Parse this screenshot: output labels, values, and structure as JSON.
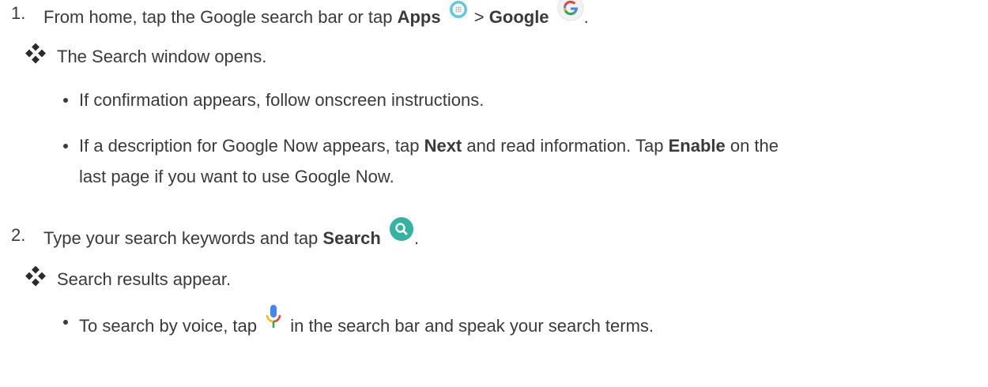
{
  "steps": [
    {
      "number": "1.",
      "text_a": "From home, tap the Google search bar or tap ",
      "apps": "Apps",
      "sep": " > ",
      "google": "Google",
      "end": ".",
      "result": "The Search window opens.",
      "bullets": [
        "If confirmation appears, follow onscreen instructions.",
        {
          "a": "If a description for Google Now appears, tap ",
          "next": "Next",
          "b": " and read information. Tap ",
          "enable": "Enable",
          "c": " on the",
          "line2": "last page if you want to use Google Now."
        }
      ]
    },
    {
      "number": "2.",
      "text_a": "Type your search keywords and tap ",
      "search": "Search",
      "end": ".",
      "result": "Search results appear.",
      "bullets": [
        {
          "a": "To search by voice, tap ",
          "b": " in the search bar and speak your search terms."
        }
      ]
    }
  ],
  "icons": {
    "apps": "apps-grid-icon",
    "google": "google-g-icon",
    "search": "search-magnifier-icon",
    "mic": "microphone-icon",
    "result": "diamond-bullet-icon"
  },
  "colors": {
    "text": "#3a3a3a",
    "apps_icon": "#5bc8e6",
    "search_icon": "#34b3a3",
    "google_blue": "#4285f4",
    "google_red": "#ea4335",
    "google_yellow": "#fbbc05",
    "google_green": "#34a853"
  }
}
